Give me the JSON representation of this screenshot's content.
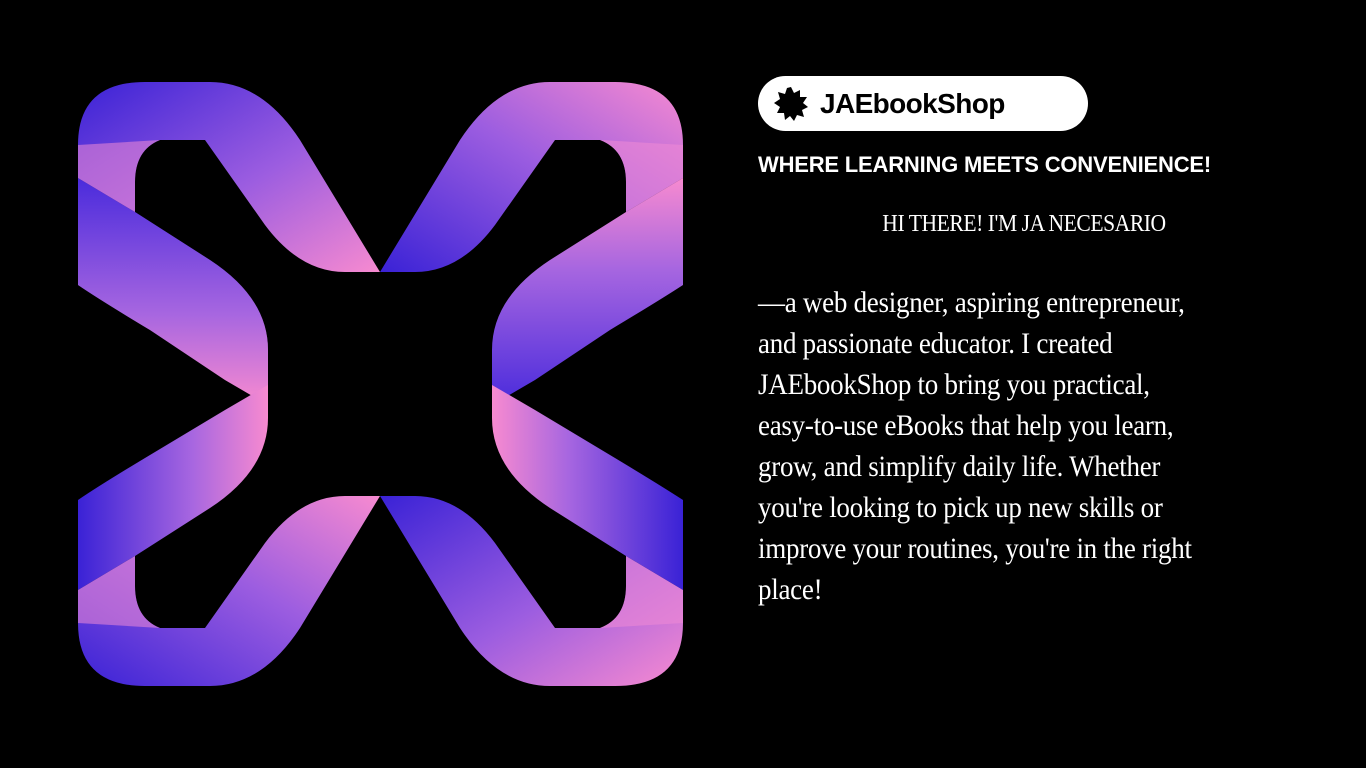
{
  "brand": {
    "name": "JAEbookShop",
    "icon": "starburst-badge-icon"
  },
  "tagline": "WHERE LEARNING MEETS CONVENIENCE!",
  "greeting": "HI THERE! I'M JA NECESARIO",
  "intro_lines": [
    "—a web designer, aspiring entrepreneur,",
    "and passionate educator. I created",
    "JAEbookShop to bring you practical,",
    "easy-to-use eBooks that help you learn,",
    "grow, and simplify daily life. Whether",
    "you're looking to pick up new skills or",
    "improve your routines, you're in the right",
    "place!"
  ],
  "colors": {
    "background": "#000000",
    "accent_violet": "#3a22d6",
    "accent_pink": "#f78ad0",
    "badge_background": "#ffffff",
    "text": "#ffffff"
  },
  "graphic": {
    "icon": "ribbon-x-logo-icon"
  }
}
